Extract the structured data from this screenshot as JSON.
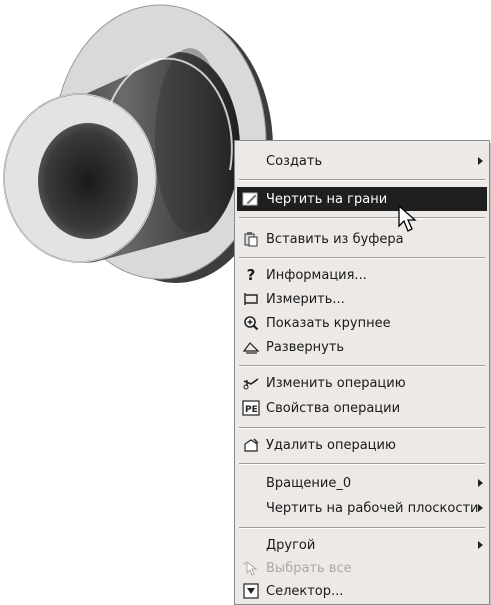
{
  "scene": {
    "object": "3d-part-flange",
    "colors": {
      "face": "#d7d7d7",
      "rim": "#444444",
      "hub": "#3a3a3a",
      "hub_face": "#e2e2e2"
    }
  },
  "context_menu": {
    "items": [
      {
        "label": "Создать",
        "submenu": true,
        "icon": ""
      },
      {
        "label": "Чертить на грани",
        "submenu": false,
        "icon": "sketch-pencil-icon",
        "highlighted": true
      },
      {
        "label": "Вставить из буфера",
        "submenu": false,
        "icon": "paste-icon"
      },
      {
        "label": "Информация...",
        "submenu": false,
        "icon": "question-mark-icon"
      },
      {
        "label": "Измерить...",
        "submenu": false,
        "icon": "measure-icon"
      },
      {
        "label": "Показать крупнее",
        "submenu": false,
        "icon": "zoom-in-icon"
      },
      {
        "label": "Развернуть",
        "submenu": false,
        "icon": "rollback-icon"
      },
      {
        "label": "Изменить операцию",
        "submenu": false,
        "icon": "edit-feature-icon"
      },
      {
        "label": "Свойства операции",
        "submenu": false,
        "icon": "properties-icon"
      },
      {
        "label": "Удалить операцию",
        "submenu": false,
        "icon": "delete-feature-icon"
      },
      {
        "label": "Вращение_0",
        "submenu": true,
        "icon": ""
      },
      {
        "label": "Чертить на рабочей плоскости",
        "submenu": true,
        "icon": ""
      },
      {
        "label": "Другой",
        "submenu": true,
        "icon": ""
      },
      {
        "label": "Выбрать все",
        "submenu": false,
        "icon": "select-all-icon",
        "disabled": true
      },
      {
        "label": "Селектор...",
        "submenu": false,
        "icon": "selector-icon"
      }
    ]
  }
}
